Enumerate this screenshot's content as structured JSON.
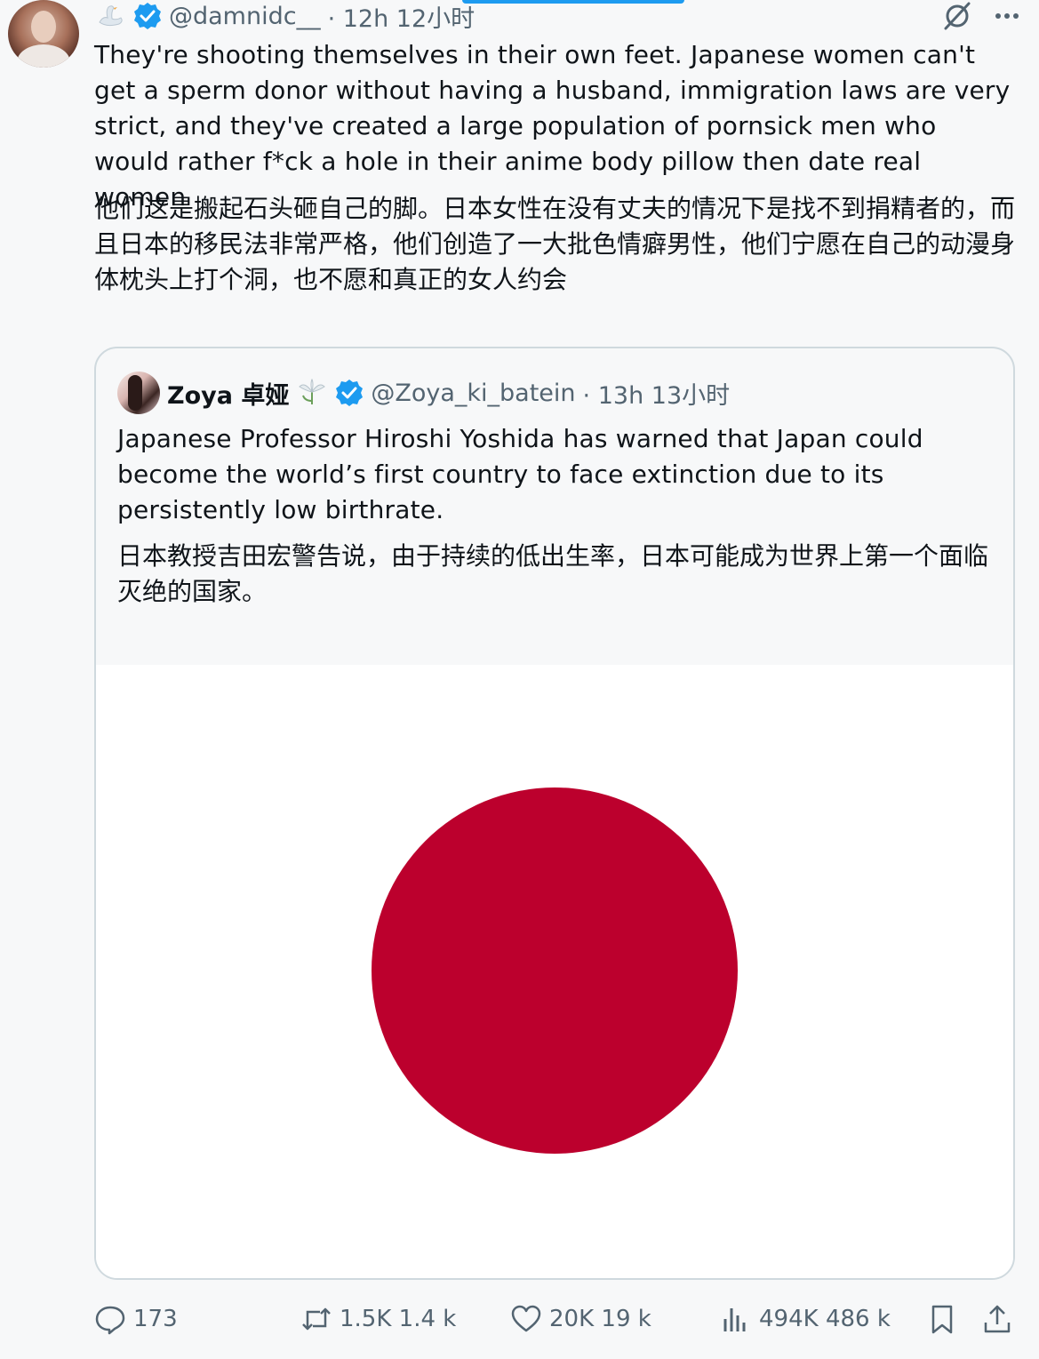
{
  "post": {
    "handle": "@damnidc__",
    "time": "· 12h 12小时",
    "text": "They're shooting themselves in their own feet. Japanese women can't get a sperm donor without having a husband, immigration laws are very strict, and they've created a large population of pornsick men who would rather f*ck a hole in their anime body pillow then date real women",
    "translation": "他们这是搬起石头砸自己的脚。日本女性在没有丈夫的情况下是找不到捐精者的，而且日本的移民法非常严格，他们创造了一大批色情癖男性，他们宁愿在自己的动漫身体枕头上打个洞，也不愿和真正的女人约会"
  },
  "quote": {
    "name": "Zoya 卓娅",
    "handle": "@Zoya_ki_batein",
    "time": "· 13h 13小时",
    "text": "Japanese Professor Hiroshi Yoshida has warned that Japan could become the world’s first country to face extinction due to its persistently low birthrate.",
    "translation": "日本教授吉田宏警告说，由于持续的低出生率，日本可能成为世界上第一个面临灭绝的国家。"
  },
  "actions": {
    "replies": "173",
    "reposts": "1.5K 1.4 k",
    "likes": "20K 19 k",
    "views": "494K 486 k"
  },
  "colors": {
    "accent": "#1d9bf0",
    "muted_text": "#536471",
    "flag_red": "#bc002d",
    "border": "#cfd9de"
  },
  "icons": {
    "header": [
      "swan-icon",
      "verified-icon",
      "grok-icon",
      "more-icon"
    ],
    "quote": [
      "verified-icon",
      "lily-icon"
    ],
    "actions": [
      "reply-icon",
      "repost-icon",
      "like-icon",
      "views-icon",
      "bookmark-icon",
      "share-icon"
    ]
  }
}
